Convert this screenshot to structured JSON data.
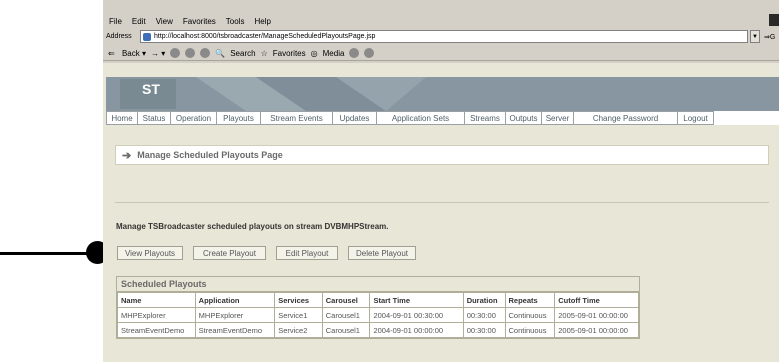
{
  "menu": [
    "File",
    "Edit",
    "View",
    "Favorites",
    "Tools",
    "Help"
  ],
  "address": {
    "label": "Address",
    "url": "http://localhost:8000/tsbroadcaster/ManageScheduledPlayoutsPage.jsp"
  },
  "toolbar": {
    "back": "Back",
    "search": "Search",
    "favorites": "Favorites",
    "media": "Media"
  },
  "logo": "ST",
  "nav": [
    {
      "label": "Home",
      "w": 32
    },
    {
      "label": "Status",
      "w": 33
    },
    {
      "label": "Operation",
      "w": 46
    },
    {
      "label": "Playouts",
      "w": 44
    },
    {
      "label": "Stream Events",
      "w": 72
    },
    {
      "label": "Updates",
      "w": 44
    },
    {
      "label": "Application Sets",
      "w": 88
    },
    {
      "label": "Streams",
      "w": 41
    },
    {
      "label": "Outputs",
      "w": 36
    },
    {
      "label": "Server",
      "w": 32
    },
    {
      "label": "Change Password",
      "w": 104
    },
    {
      "label": "Logout",
      "w": 36
    }
  ],
  "page": {
    "title": "Manage Scheduled Playouts Page",
    "description": "Manage TSBroadcaster scheduled playouts on stream DVBMHPStream."
  },
  "buttons": [
    {
      "label": "View Playouts",
      "w": 66
    },
    {
      "label": "Create Playout",
      "w": 73
    },
    {
      "label": "Edit Playout",
      "w": 62
    },
    {
      "label": "Delete Playout",
      "w": 68
    }
  ],
  "scheduled": {
    "title": "Scheduled Playouts",
    "columns": [
      "Name",
      "Application",
      "Services",
      "Carousel",
      "Start Time",
      "Duration",
      "Repeats",
      "Cutoff Time"
    ],
    "rows": [
      [
        "MHPExplorer",
        "MHPExplorer",
        "Service1",
        "Carousel1",
        "2004-09-01 00:30:00",
        "00:30:00",
        "Continuous",
        "2005-09-01 00:00:00"
      ],
      [
        "StreamEventDemo",
        "StreamEventDemo",
        "Service2",
        "Carousel1",
        "2004-09-01 00:00:00",
        "00:30:00",
        "Continuous",
        "2005-09-01 00:00:00"
      ]
    ]
  }
}
